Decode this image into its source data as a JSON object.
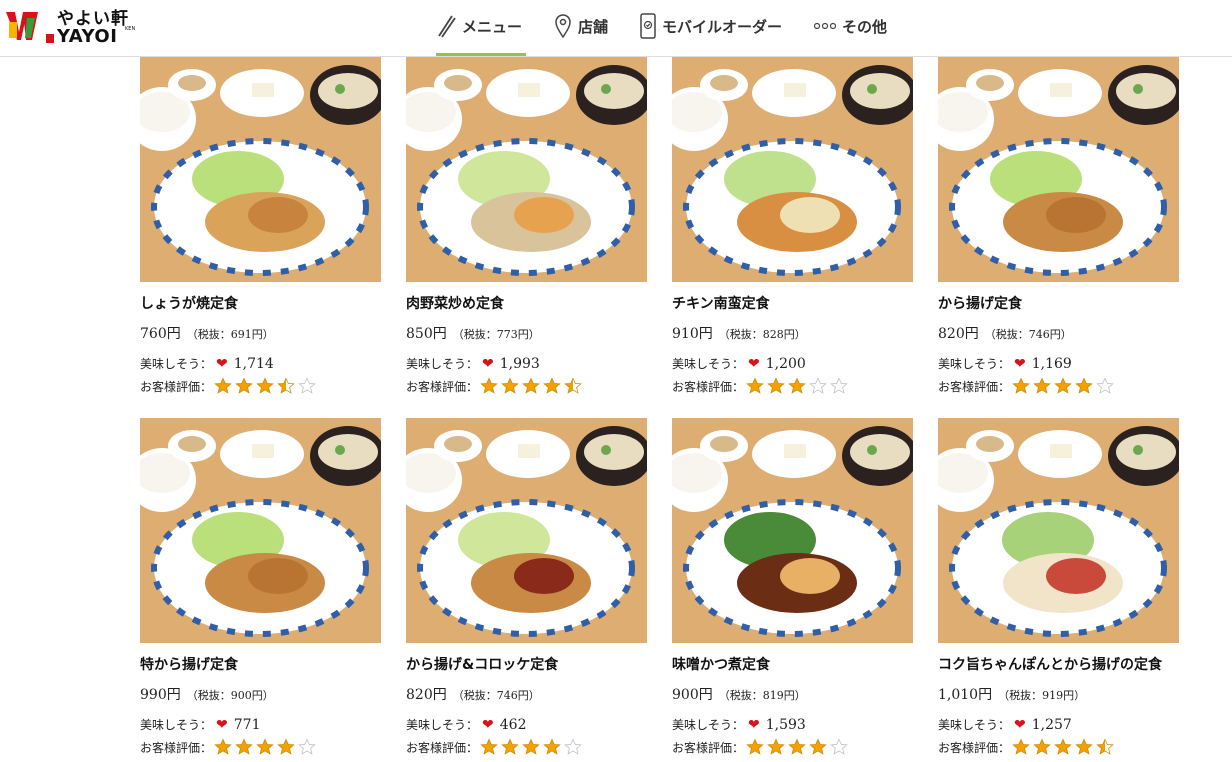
{
  "brand": {
    "name_jp": "やよい軒",
    "name_en": "YAYOI",
    "vertical": "KEN"
  },
  "nav": [
    {
      "label": "メニュー",
      "icon": "chopsticks-icon",
      "active": true
    },
    {
      "label": "店舗",
      "icon": "location-pin-icon",
      "active": false
    },
    {
      "label": "モバイルオーダー",
      "icon": "smartphone-order-icon",
      "active": false
    },
    {
      "label": "その他",
      "icon": "more-dots-icon",
      "active": false
    }
  ],
  "labels": {
    "likes": "美味しそう：",
    "rating": "お客様評価："
  },
  "colors": {
    "accent_green": "#9ac437",
    "heart_red": "#d8121b",
    "star_gold": "#f2a100"
  },
  "items": [
    {
      "name": "しょうが焼定食",
      "price": "760円",
      "tax": "（税抜：691円）",
      "likes": "1,714",
      "rating": 3.5
    },
    {
      "name": "肉野菜炒め定食",
      "price": "850円",
      "tax": "（税抜：773円）",
      "likes": "1,993",
      "rating": 4.5
    },
    {
      "name": "チキン南蛮定食",
      "price": "910円",
      "tax": "（税抜：828円）",
      "likes": "1,200",
      "rating": 3
    },
    {
      "name": "から揚げ定食",
      "price": "820円",
      "tax": "（税抜：746円）",
      "likes": "1,169",
      "rating": 4
    },
    {
      "name": "特から揚げ定食",
      "price": "990円",
      "tax": "（税抜：900円）",
      "likes": "771",
      "rating": 4
    },
    {
      "name": "から揚げ&コロッケ定食",
      "price": "820円",
      "tax": "（税抜：746円）",
      "likes": "462",
      "rating": 4
    },
    {
      "name": "味噌かつ煮定食",
      "price": "900円",
      "tax": "（税抜：819円）",
      "likes": "1,593",
      "rating": 4
    },
    {
      "name": "コク旨ちゃんぽんとから揚げの定食",
      "price": "1,010円",
      "tax": "（税抜：919円）",
      "likes": "1,257",
      "rating": 4.5
    }
  ]
}
